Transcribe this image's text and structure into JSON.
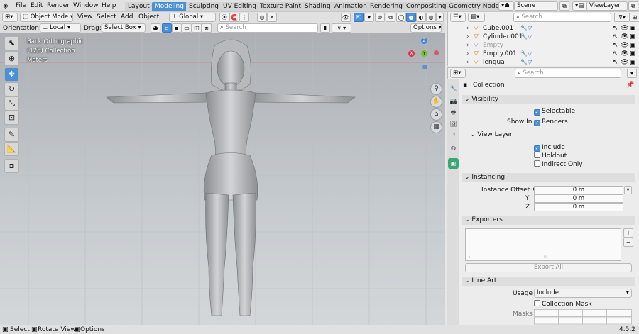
{
  "topbar": {
    "menus": [
      "File",
      "Edit",
      "Render",
      "Window",
      "Help"
    ],
    "workspaces": [
      "Layout",
      "Modeling",
      "Sculpting",
      "UV Editing",
      "Texture Paint",
      "Shading",
      "Animation",
      "Rendering",
      "Compositing",
      "Geometry Nodes"
    ],
    "active_workspace": "Modeling",
    "scene": "Scene",
    "view_layer": "ViewLayer"
  },
  "header": {
    "mode": "Object Mode",
    "menus": [
      "View",
      "Select",
      "Add",
      "Object"
    ],
    "transform_orientation": "Global",
    "orientation_label": "Orientation:",
    "orientation_value": "Local",
    "drag_label": "Drag:",
    "drag_value": "Select Box",
    "search_placeholder": "Search",
    "options": "Options"
  },
  "viewport": {
    "view_name": "Back Orthographic",
    "collection": "(125) Collection",
    "units": "Meters",
    "gizmo_axes": [
      "X",
      "Y",
      "Z"
    ]
  },
  "outliner": {
    "search_placeholder": "Search",
    "items": [
      {
        "name": "Cube.001",
        "color": "#e08a2a"
      },
      {
        "name": "Cylinder.001",
        "color": "#e08a2a"
      },
      {
        "name": "Empty",
        "color": "#999999"
      },
      {
        "name": "Empty.001",
        "color": "#e08a2a"
      },
      {
        "name": "lengua",
        "color": "#e08a2a"
      }
    ]
  },
  "properties": {
    "search_placeholder": "Search",
    "context": "Collection",
    "visibility": {
      "title": "Visibility",
      "selectable": "Selectable",
      "show_in": "Show In",
      "renders": "Renders",
      "view_layer": "View Layer",
      "include": "Include",
      "holdout": "Holdout",
      "indirect_only": "Indirect Only"
    },
    "instancing": {
      "title": "Instancing",
      "offset_x_label": "Instance Offset X",
      "y_label": "Y",
      "z_label": "Z",
      "x": "0 m",
      "y": "0 m",
      "z": "0 m"
    },
    "exporters": {
      "title": "Exporters",
      "export_all": "Export All"
    },
    "line_art": {
      "title": "Line Art",
      "usage_label": "Usage",
      "usage_value": "Include",
      "collection_mask": "Collection Mask",
      "masks": "Masks"
    }
  },
  "statusbar": {
    "select": "Select",
    "rotate": "Rotate View",
    "options": "Options",
    "version": "4.5.2"
  },
  "colors": {
    "accent": "#4a90d9",
    "object_orange": "#e08a2a",
    "outliner_green": "#3aa874"
  }
}
